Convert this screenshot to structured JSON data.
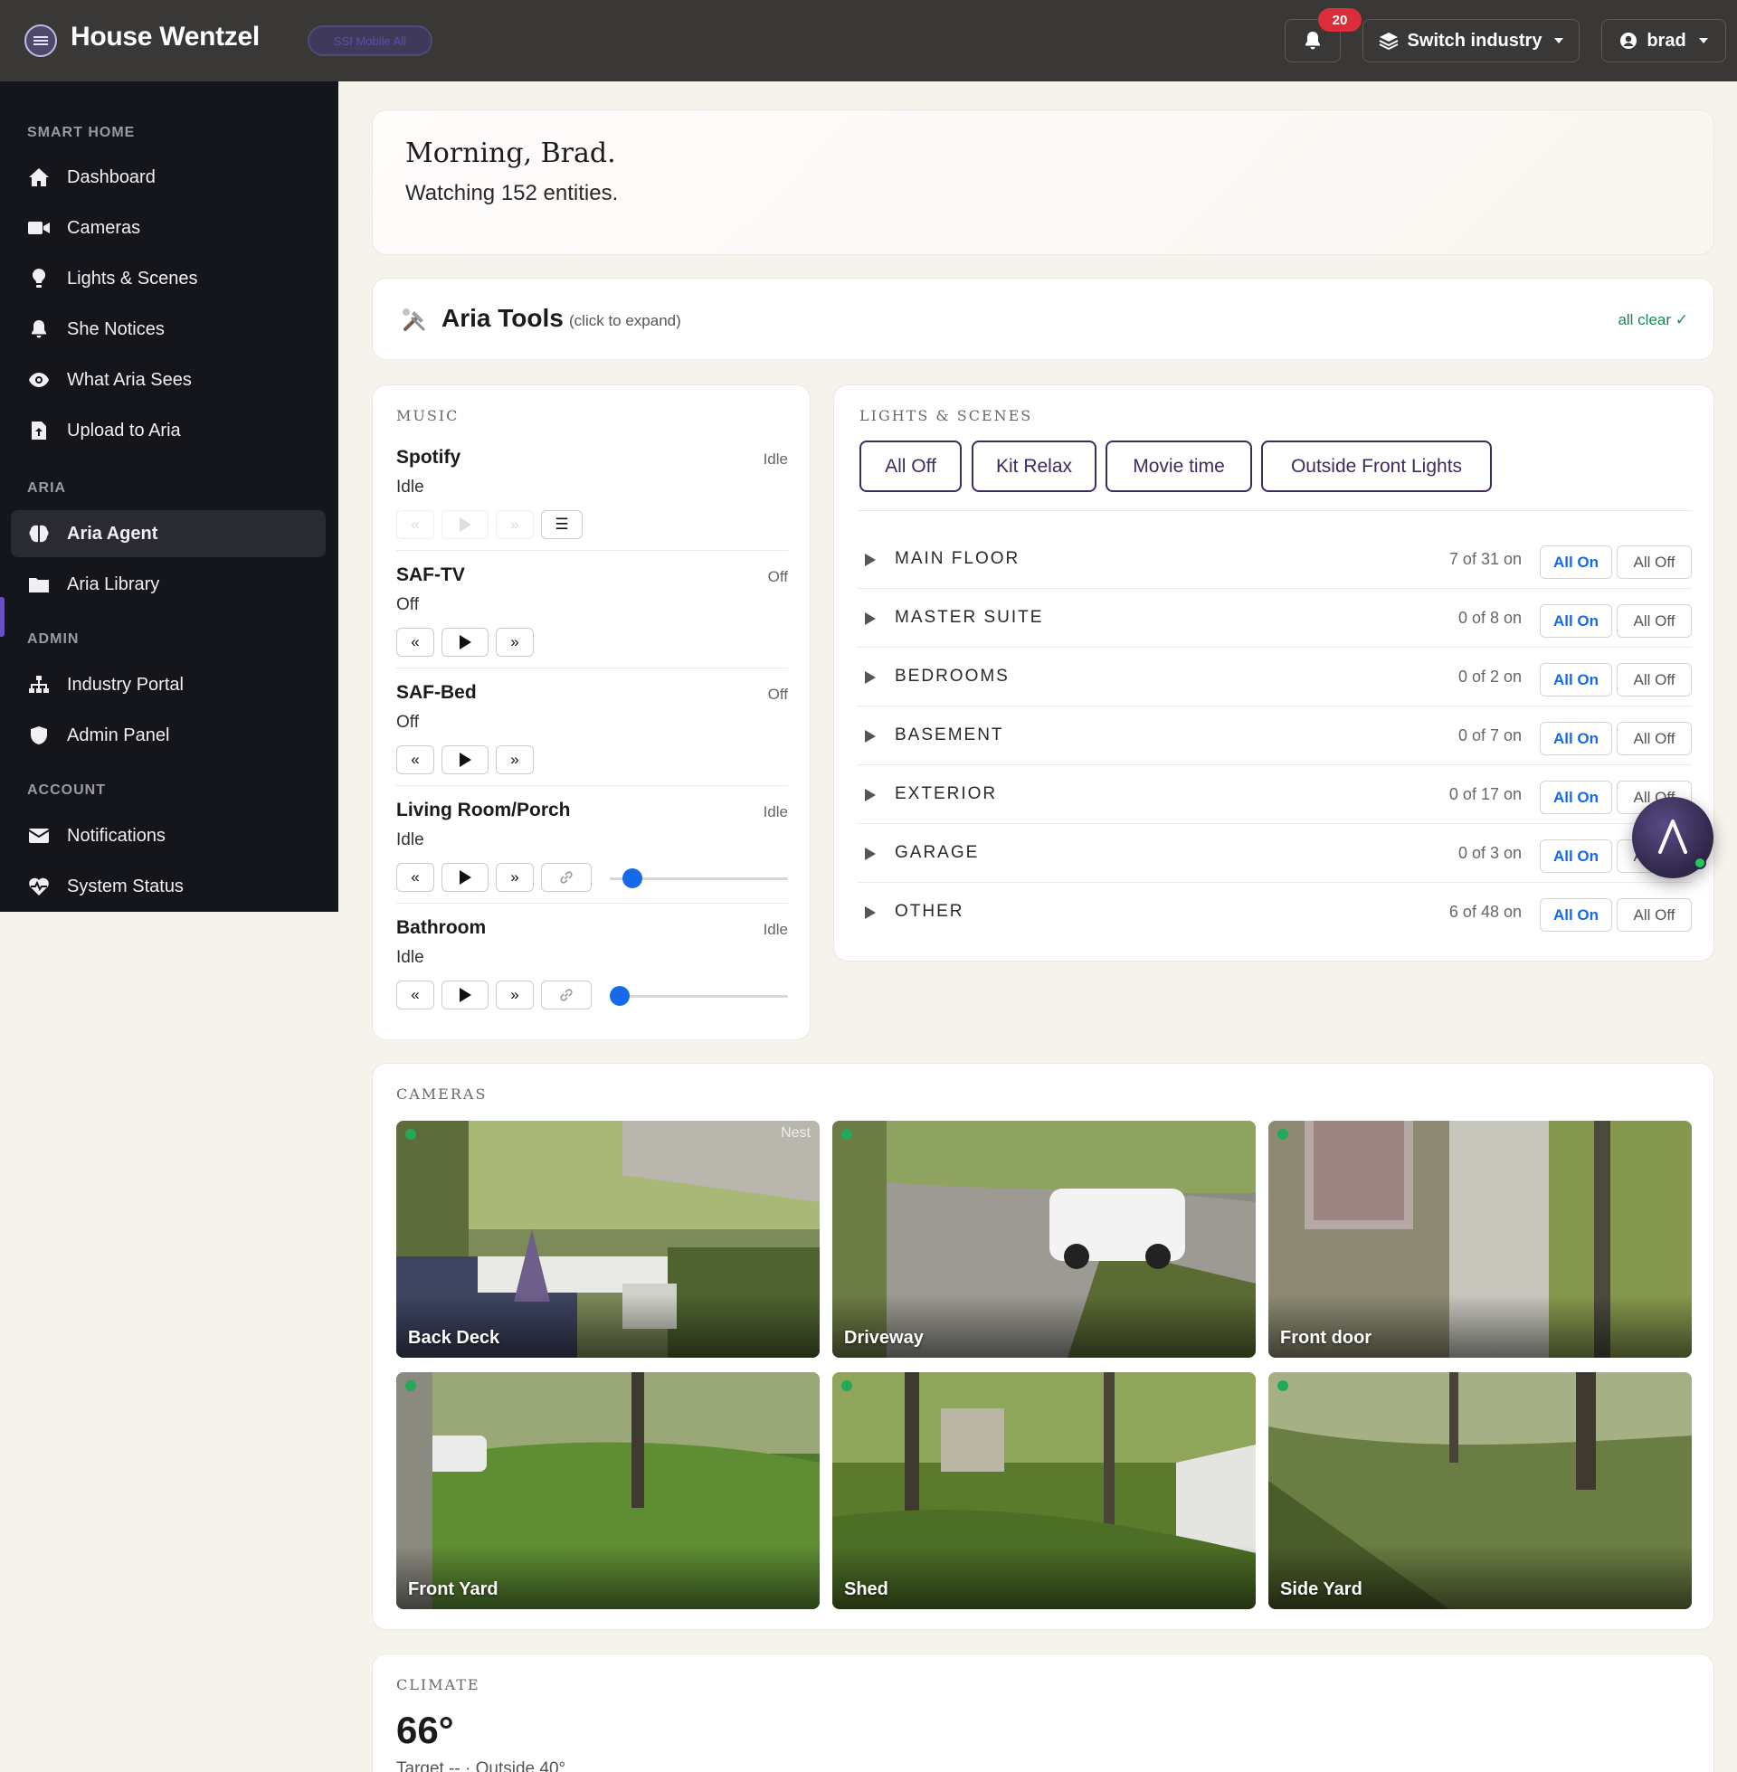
{
  "header": {
    "title": "House Wentzel",
    "env_badge": "SSI Mobile All",
    "notification_count": "20",
    "switch_label": "Switch industry",
    "user_label": "brad"
  },
  "sidebar": {
    "sections": [
      {
        "label": "SMART HOME",
        "items": [
          {
            "label": "Dashboard",
            "icon": "home-icon"
          },
          {
            "label": "Cameras",
            "icon": "video-camera-icon"
          },
          {
            "label": "Lights & Scenes",
            "icon": "lightbulb-icon"
          },
          {
            "label": "She Notices",
            "icon": "bell-icon"
          },
          {
            "label": "What Aria Sees",
            "icon": "eye-icon"
          },
          {
            "label": "Upload to Aria",
            "icon": "file-upload-icon"
          }
        ]
      },
      {
        "label": "ARIA",
        "items": [
          {
            "label": "Aria Agent",
            "icon": "brain-icon",
            "active": true
          },
          {
            "label": "Aria Library",
            "icon": "folder-icon"
          }
        ]
      },
      {
        "label": "ADMIN",
        "items": [
          {
            "label": "Industry Portal",
            "icon": "sitemap-icon"
          },
          {
            "label": "Admin Panel",
            "icon": "shield-icon"
          }
        ]
      },
      {
        "label": "ACCOUNT",
        "items": [
          {
            "label": "Notifications",
            "icon": "envelope-icon"
          },
          {
            "label": "System Status",
            "icon": "heartbeat-icon"
          }
        ]
      }
    ]
  },
  "greeting": {
    "title": "Morning, Brad.",
    "subtitle": "Watching 152 entities."
  },
  "tools": {
    "title": "Aria Tools",
    "hint": "(click to expand)",
    "status": "all clear ✓"
  },
  "music": {
    "label": "MUSIC",
    "players": [
      {
        "name": "Spotify",
        "state": "Idle",
        "sub": "Idle",
        "controls": "disabled",
        "has_queue": true
      },
      {
        "name": "SAF-TV",
        "state": "Off",
        "sub": "Off",
        "controls": "basic"
      },
      {
        "name": "SAF-Bed",
        "state": "Off",
        "sub": "Off",
        "controls": "basic"
      },
      {
        "name": "Living Room/Porch",
        "state": "Idle",
        "sub": "Idle",
        "controls": "volume",
        "volume": 0.08
      },
      {
        "name": "Bathroom",
        "state": "Idle",
        "sub": "Idle",
        "controls": "volume",
        "volume": 0.0
      }
    ],
    "prev_symbol": "«",
    "next_symbol": "»",
    "queue_symbol": "☰",
    "link_symbol": "🔗"
  },
  "lights": {
    "label": "LIGHTS & SCENES",
    "scenes": [
      "All Off",
      "Kit Relax",
      "Movie time",
      "Outside Front Lights"
    ],
    "areas": [
      {
        "name": "MAIN FLOOR",
        "count": "7 of 31 on"
      },
      {
        "name": "MASTER SUITE",
        "count": "0 of 8 on"
      },
      {
        "name": "BEDROOMS",
        "count": "0 of 2 on"
      },
      {
        "name": "BASEMENT",
        "count": "0 of 7 on"
      },
      {
        "name": "EXTERIOR",
        "count": "0 of 17 on"
      },
      {
        "name": "GARAGE",
        "count": "0 of 3 on"
      },
      {
        "name": "OTHER",
        "count": "6 of 48 on"
      }
    ],
    "all_on_label": "All On",
    "all_off_label": "All Off"
  },
  "cameras": {
    "label": "CAMERAS",
    "items": [
      {
        "name": "Back Deck",
        "tag": "Nest"
      },
      {
        "name": "Driveway",
        "tag": ""
      },
      {
        "name": "Front door",
        "tag": ""
      },
      {
        "name": "Front Yard",
        "tag": ""
      },
      {
        "name": "Shed",
        "tag": ""
      },
      {
        "name": "Side Yard",
        "tag": ""
      }
    ]
  },
  "climate": {
    "label": "CLIMATE",
    "temp": "66°",
    "sub": "Target -- · Outside 40°"
  },
  "colors": {
    "accent": "#3e2a5e",
    "link_blue": "#1669e8",
    "status_green": "#198754",
    "badge_red": "#dc2e3a"
  }
}
